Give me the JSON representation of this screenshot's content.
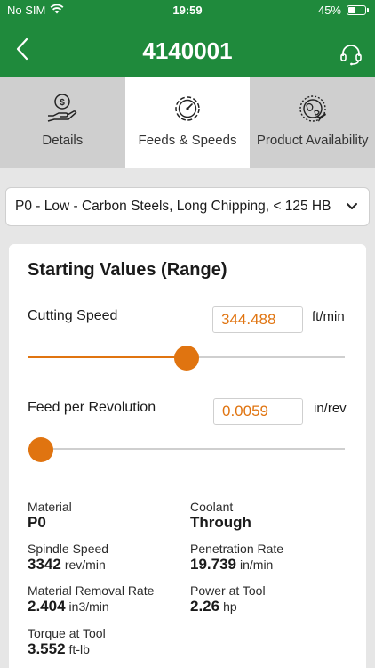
{
  "status_bar": {
    "carrier": "No SIM",
    "time": "19:59",
    "battery": "45%",
    "battery_level": 0.45
  },
  "nav": {
    "title": "4140001"
  },
  "tabs": [
    {
      "label": "Details",
      "icon": "hand-coin-icon",
      "active": false
    },
    {
      "label": "Feeds & Speeds",
      "icon": "gear-gauge-icon",
      "active": true
    },
    {
      "label": "Product Availability",
      "icon": "globe-plane-icon",
      "active": false
    }
  ],
  "material_select": {
    "value": "P0 - Low - Carbon Steels, Long Chipping, < 125 HB"
  },
  "card": {
    "title": "Starting Values (Range)",
    "cutting_speed": {
      "label": "Cutting Speed",
      "value": "344.488",
      "unit": "ft/min",
      "slider_fraction": 0.5
    },
    "feed_per_revolution": {
      "label": "Feed per Revolution",
      "value": "0.0059",
      "unit": "in/rev",
      "slider_fraction": 0.04
    },
    "metrics": {
      "material": {
        "label": "Material",
        "value": "P0",
        "unit": ""
      },
      "coolant": {
        "label": "Coolant",
        "value": "Through",
        "unit": ""
      },
      "spindle_speed": {
        "label": "Spindle Speed",
        "value": "3342",
        "unit": "rev/min"
      },
      "penetration_rate": {
        "label": "Penetration Rate",
        "value": "19.739",
        "unit": "in/min"
      },
      "material_removal_rate": {
        "label": "Material Removal Rate",
        "value": "2.404",
        "unit": "in3/min"
      },
      "power_at_tool": {
        "label": "Power at Tool",
        "value": "2.26",
        "unit": "hp"
      },
      "torque_at_tool": {
        "label": "Torque at Tool",
        "value": "3.552",
        "unit": "ft-lb"
      }
    }
  },
  "colors": {
    "brand_green": "#1f8a3c",
    "accent_orange": "#e07410",
    "tab_inactive": "#cfcfcf"
  }
}
